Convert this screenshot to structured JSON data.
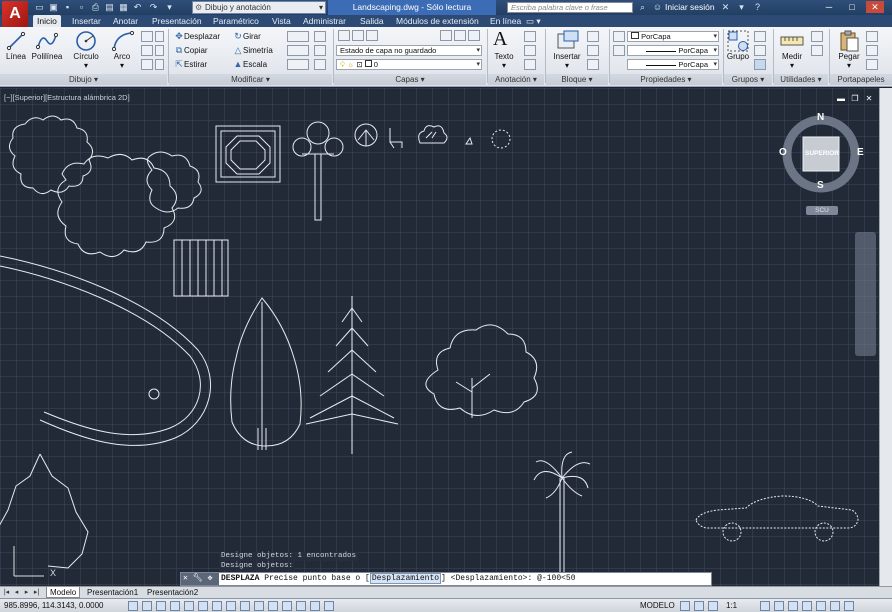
{
  "window": {
    "workspace": "Dibujo y anotación",
    "title": "Landscaping.dwg - Sólo lectura",
    "search_placeholder": "Escriba palabra clave o frase",
    "login": "Iniciar sesión",
    "minimize": "─",
    "maximize": "□",
    "close": "✕"
  },
  "tabs": [
    "Inicio",
    "Insertar",
    "Anotar",
    "Presentación",
    "Paramétrico",
    "Vista",
    "Administrar",
    "Salida",
    "Módulos de extensión",
    "En línea"
  ],
  "ribbon": {
    "dibujo": {
      "label": "Dibujo",
      "linea": "Línea",
      "polilinea": "Polilínea",
      "circulo": "Círculo",
      "arco": "Arco"
    },
    "modificar": {
      "label": "Modificar",
      "desplazar": "Desplazar",
      "girar": "Girar",
      "copiar": "Copiar",
      "simetria": "Simetría",
      "estirar": "Estirar",
      "escala": "Escala"
    },
    "capas": {
      "label": "Capas",
      "estado": "Estado de capa no guardado",
      "capa_actual": "0"
    },
    "anotacion": {
      "label": "Anotación",
      "texto": "Texto"
    },
    "bloque": {
      "label": "Bloque",
      "insertar": "Insertar"
    },
    "propiedades": {
      "label": "Propiedades",
      "color": "PorCapa",
      "linetype": "PorCapa",
      "lineweight": "PorCapa"
    },
    "grupos": {
      "label": "Grupos",
      "grupo": "Grupo"
    },
    "utilidades": {
      "label": "Utilidades",
      "medir": "Medir"
    },
    "portapapeles": {
      "label": "Portapapeles",
      "pegar": "Pegar"
    }
  },
  "viewport": {
    "label": "[−][Superior][Estructura alámbrica 2D]",
    "viewcube": {
      "north": "N",
      "south": "S",
      "east": "E",
      "west": "O",
      "face": "SUPERIOR",
      "ucs": "SCU"
    }
  },
  "command": {
    "history": [
      "Designe objetos: 1 encontrados",
      "Designe objetos:"
    ],
    "name": "DESPLAZA",
    "prompt": "Precise punto base o",
    "option": "Desplazamiento",
    "rest": "<Desplazamiento>:",
    "input": "@-100<50"
  },
  "layout_tabs": [
    "Modelo",
    "Presentación1",
    "Presentación2"
  ],
  "status": {
    "coords": "985.8996, 114.3143, 0.0000",
    "space": "MODELO",
    "scale": "1:1"
  }
}
